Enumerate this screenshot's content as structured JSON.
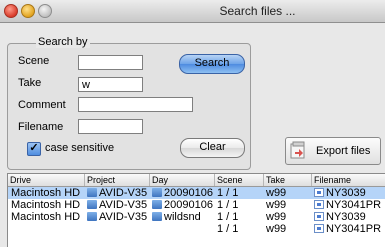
{
  "window": {
    "title": "Search files ..."
  },
  "search_by": {
    "title": "Search by",
    "scene_label": "Scene",
    "scene_value": "",
    "take_label": "Take",
    "take_value": "w",
    "comment_label": "Comment",
    "comment_value": "",
    "filename_label": "Filename",
    "filename_value": "",
    "case_sensitive_label": "case sensitive",
    "case_sensitive_checked": true,
    "search_button": "Search",
    "clear_button": "Clear"
  },
  "export_button": "Export files",
  "table": {
    "columns": [
      "Drive",
      "Project",
      "Day",
      "Scene",
      "Take",
      "Filename"
    ],
    "rows": [
      {
        "drive": "Macintosh HD",
        "project": "AVID-V35",
        "day": "20090106",
        "scene": "1 / 1",
        "take": "w99",
        "filename": "NY3039",
        "selected": true
      },
      {
        "drive": "Macintosh HD",
        "project": "AVID-V35",
        "day": "20090106",
        "scene": "1 / 1",
        "take": "w99",
        "filename": "NY3041PR",
        "selected": false
      },
      {
        "drive": "Macintosh HD",
        "project": "AVID-V35",
        "day": "wildsnd",
        "scene": "1 / 1",
        "take": "w99",
        "filename": "NY3039",
        "selected": false
      },
      {
        "drive": "",
        "project": "",
        "day": "",
        "scene": "1 / 1",
        "take": "w99",
        "filename": "NY3041PR",
        "selected": false
      }
    ]
  },
  "colors": {
    "selection": "#b5d4f8",
    "search_button": "#4e8be0"
  }
}
